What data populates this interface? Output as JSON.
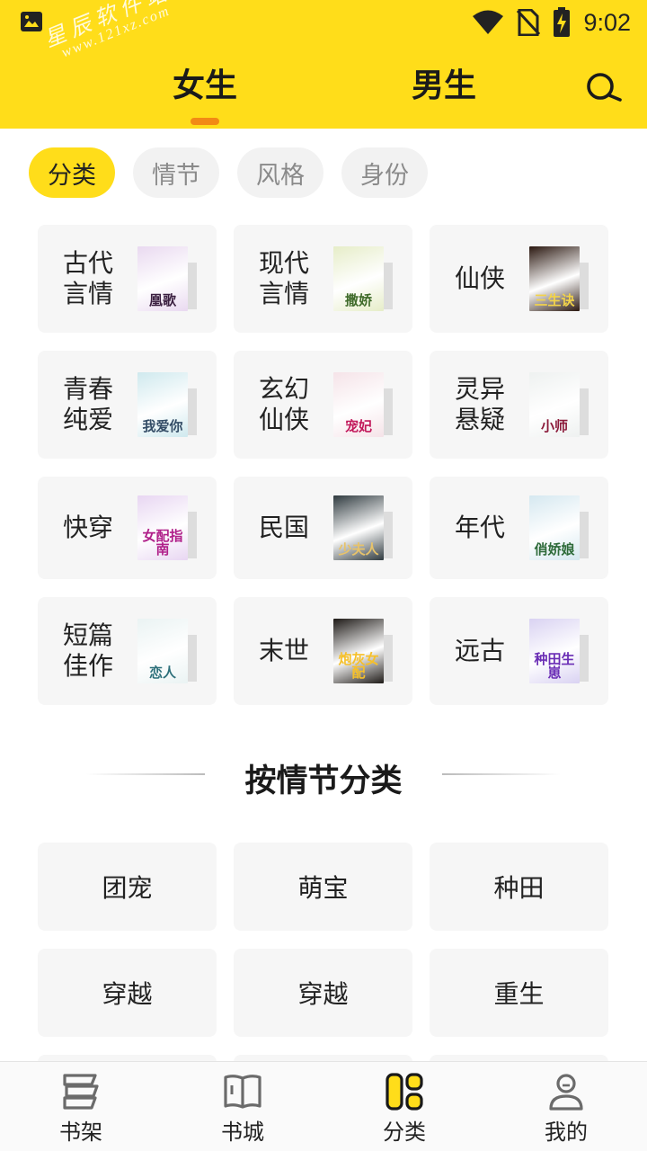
{
  "status_bar": {
    "time": "9:02",
    "icons": [
      "image-icon",
      "wifi-icon",
      "no-sim-icon",
      "battery-charging-icon"
    ]
  },
  "watermark": {
    "line1": "星辰软件站",
    "line2": "www.121xz.com"
  },
  "header": {
    "tabs": [
      {
        "label": "女生",
        "active": true
      },
      {
        "label": "男生",
        "active": false
      }
    ],
    "search_icon": "search-icon",
    "accent_color": "#FFDD1A",
    "indicator_color": "#F28A14"
  },
  "filters": [
    {
      "label": "分类",
      "active": true
    },
    {
      "label": "情节",
      "active": false
    },
    {
      "label": "风格",
      "active": false
    },
    {
      "label": "身份",
      "active": false
    }
  ],
  "genres": [
    {
      "label": "古代言情",
      "cover_text": "凰歌",
      "cover_bg": "#E9D9F0",
      "cover_fg": "#3a1f40"
    },
    {
      "label": "现代言情",
      "cover_text": "撒娇",
      "cover_bg": "#E6EDC8",
      "cover_fg": "#3f6b2a"
    },
    {
      "label": "仙侠",
      "cover_text": "三生诀",
      "cover_bg": "#2B1810",
      "cover_fg": "#F2D34A"
    },
    {
      "label": "青春纯爱",
      "cover_text": "我爱你",
      "cover_bg": "#CFE9EE",
      "cover_fg": "#334c66"
    },
    {
      "label": "玄幻仙侠",
      "cover_text": "宠妃",
      "cover_bg": "#F5E3E8",
      "cover_fg": "#C2185B"
    },
    {
      "label": "灵异悬疑",
      "cover_text": "小师",
      "cover_bg": "#EEF1F0",
      "cover_fg": "#8B1A3A"
    },
    {
      "label": "快穿",
      "cover_text": "女配指南",
      "cover_bg": "#E8D6F2",
      "cover_fg": "#B0208A"
    },
    {
      "label": "民国",
      "cover_text": "少夫人",
      "cover_bg": "#2F3A3F",
      "cover_fg": "#E7C36A"
    },
    {
      "label": "年代",
      "cover_text": "俏娇娘",
      "cover_bg": "#D5E8F0",
      "cover_fg": "#2E6B3A"
    },
    {
      "label": "短篇佳作",
      "cover_text": "恋人",
      "cover_bg": "#EAF3F3",
      "cover_fg": "#2c6f7a"
    },
    {
      "label": "末世",
      "cover_text": "炮灰女配",
      "cover_bg": "#1E1A17",
      "cover_fg": "#F6C02A"
    },
    {
      "label": "远古",
      "cover_text": "种田生崽",
      "cover_bg": "#D9D2F2",
      "cover_fg": "#6A2DB5"
    }
  ],
  "plot_section": {
    "title": "按情节分类",
    "items": [
      "团宠",
      "萌宝",
      "种田",
      "穿越",
      "穿越",
      "重生"
    ]
  },
  "bottom_nav": [
    {
      "label": "书架",
      "icon": "bookshelf-icon",
      "active": false
    },
    {
      "label": "书城",
      "icon": "book-icon",
      "active": false
    },
    {
      "label": "分类",
      "icon": "category-icon",
      "active": true
    },
    {
      "label": "我的",
      "icon": "profile-icon",
      "active": false
    }
  ]
}
